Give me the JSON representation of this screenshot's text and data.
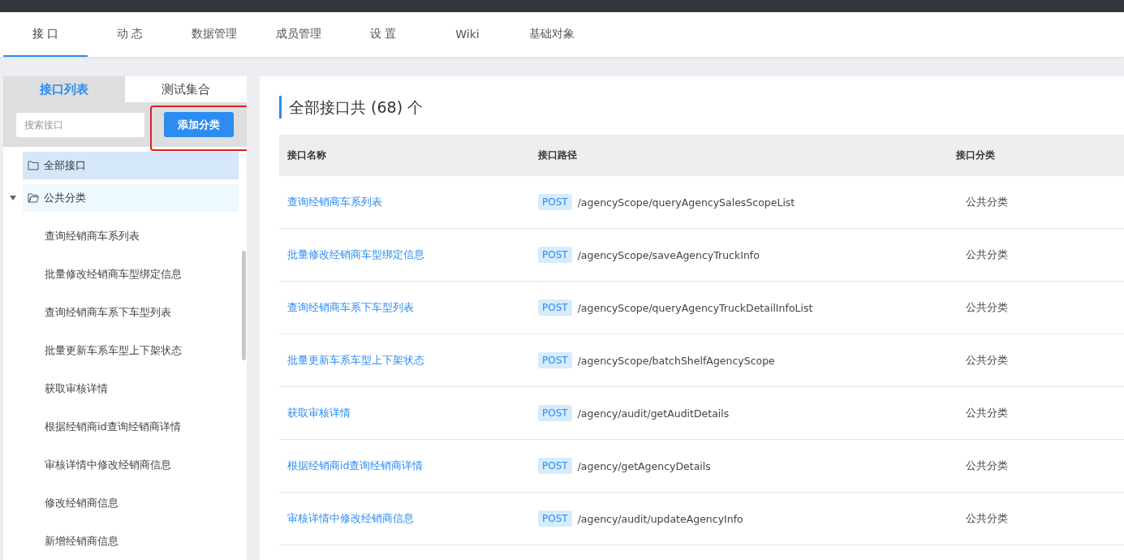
{
  "nav": {
    "tabs": [
      {
        "label": "接 口",
        "selected": true
      },
      {
        "label": "动 态",
        "selected": false
      },
      {
        "label": "数据管理",
        "selected": false
      },
      {
        "label": "成员管理",
        "selected": false
      },
      {
        "label": "设 置",
        "selected": false
      },
      {
        "label": "Wiki",
        "selected": false
      },
      {
        "label": "基础对象",
        "selected": false
      }
    ]
  },
  "sidebar": {
    "tabs": [
      {
        "label": "接口列表",
        "selected": true
      },
      {
        "label": "测试集合",
        "selected": false
      }
    ],
    "search": {
      "placeholder": "搜索接口"
    },
    "add_button": {
      "label": "添加分类",
      "highlighted": true
    },
    "tree": [
      {
        "label": "全部接口",
        "selected": true,
        "hovered": false,
        "expanded": false
      },
      {
        "label": "公共分类",
        "selected": false,
        "hovered": true,
        "expanded": true,
        "children": [
          {
            "label": "查询经销商车系列表"
          },
          {
            "label": "批量修改经销商车型绑定信息"
          },
          {
            "label": "查询经销商车系下车型列表"
          },
          {
            "label": "批量更新车系车型上下架状态"
          },
          {
            "label": "获取审核详情"
          },
          {
            "label": "根据经销商id查询经销商详情"
          },
          {
            "label": "审核详情中修改经销商信息"
          },
          {
            "label": "修改经销商信息"
          },
          {
            "label": "新增经销商信息"
          }
        ]
      }
    ]
  },
  "main": {
    "title": "全部接口共 (68) 个",
    "columns": [
      "接口名称",
      "接口路径",
      "接口分类"
    ],
    "rows": [
      {
        "name": "查询经销商车系列表",
        "method": "POST",
        "path": "/agencyScope/queryAgencySalesScopeList",
        "category": "公共分类"
      },
      {
        "name": "批量修改经销商车型绑定信息",
        "method": "POST",
        "path": "/agencyScope/saveAgencyTruckInfo",
        "category": "公共分类"
      },
      {
        "name": "查询经销商车系下车型列表",
        "method": "POST",
        "path": "/agencyScope/queryAgencyTruckDetailInfoList",
        "category": "公共分类"
      },
      {
        "name": "批量更新车系车型上下架状态",
        "method": "POST",
        "path": "/agencyScope/batchShelfAgencyScope",
        "category": "公共分类"
      },
      {
        "name": "获取审核详情",
        "method": "POST",
        "path": "/agency/audit/getAuditDetails",
        "category": "公共分类"
      },
      {
        "name": "根据经销商id查询经销商详情",
        "method": "POST",
        "path": "/agency/getAgencyDetails",
        "category": "公共分类"
      },
      {
        "name": "审核详情中修改经销商信息",
        "method": "POST",
        "path": "/agency/audit/updateAgencyInfo",
        "category": "公共分类"
      }
    ]
  }
}
